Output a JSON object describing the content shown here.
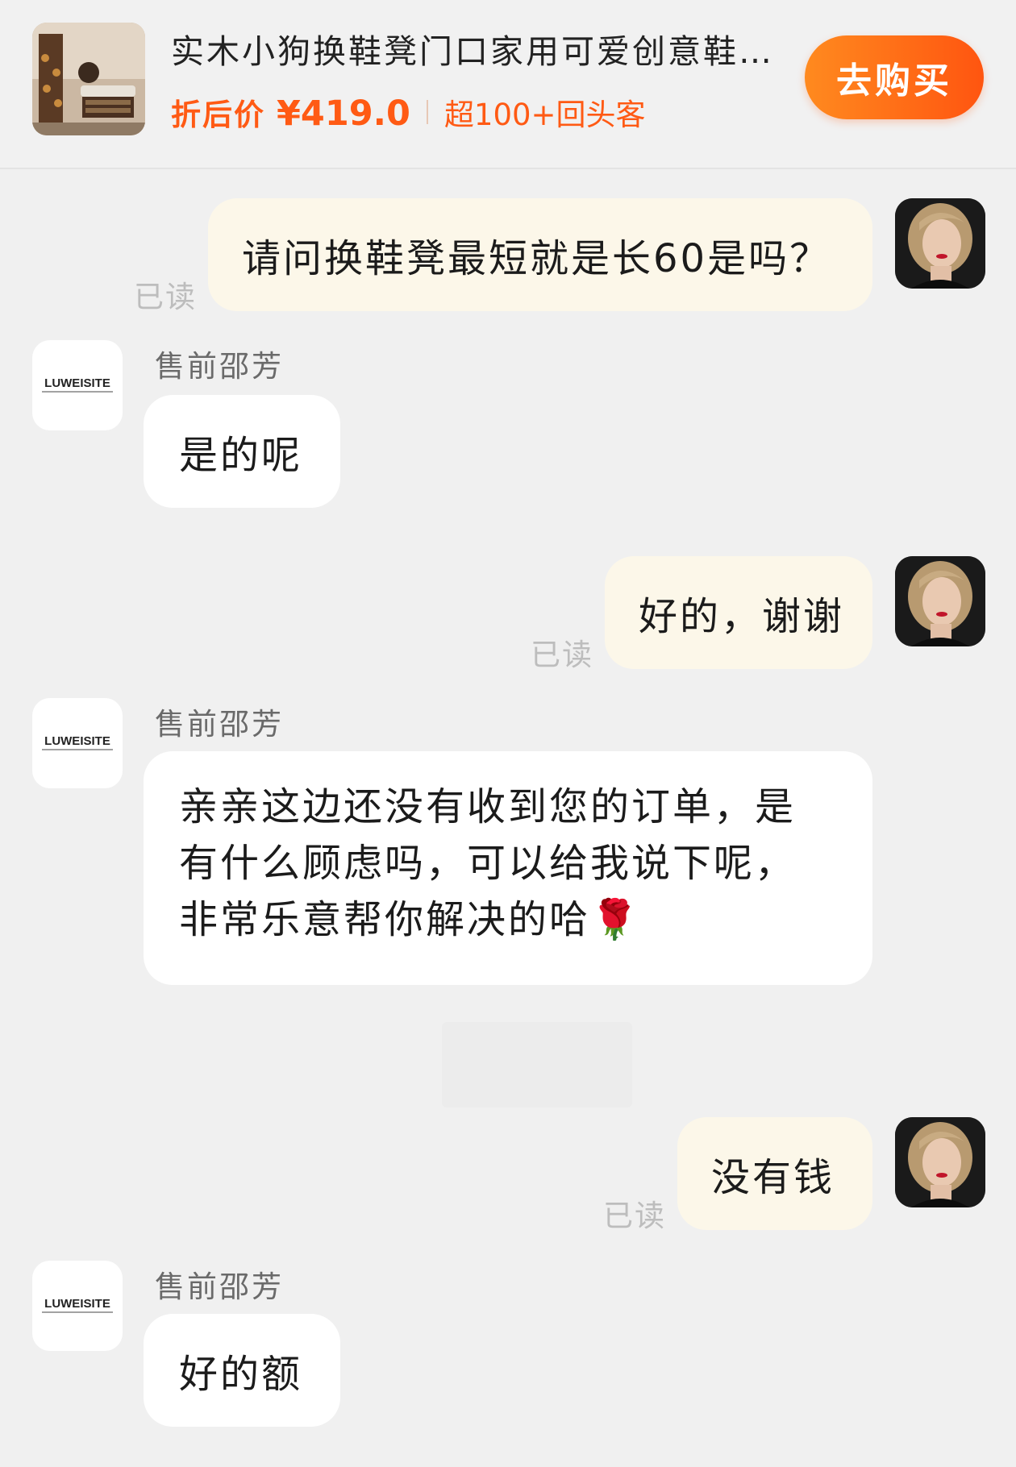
{
  "product": {
    "title": "实木小狗换鞋凳门口家用可爱创意鞋…",
    "price_label": "折后价",
    "price": "¥419.0",
    "repeat_customers": "超100+回头客",
    "buy_button": "去购买"
  },
  "shop": {
    "logo_text": "LUWEISITE",
    "agent_name": "售前邵芳"
  },
  "read_label": "已读",
  "messages": [
    {
      "from": "user",
      "text": "请问换鞋凳最短就是长60是吗？"
    },
    {
      "from": "agent",
      "text": "是的呢"
    },
    {
      "from": "user",
      "text": "好的，谢谢"
    },
    {
      "from": "agent",
      "lines": [
        "亲亲这边还没有收到您的订单，是",
        "有什么顾虑吗，可以给我说下呢，",
        "非常乐意帮你解决的哈"
      ],
      "emoji": "🌹"
    },
    {
      "from": "user",
      "text": "没有钱"
    },
    {
      "from": "agent",
      "text": "好的额"
    }
  ],
  "colors": {
    "accent": "#ff5a14",
    "outgoing_bubble": "#fcf7e9",
    "incoming_bubble": "#ffffff",
    "background": "#f0f0f0"
  }
}
